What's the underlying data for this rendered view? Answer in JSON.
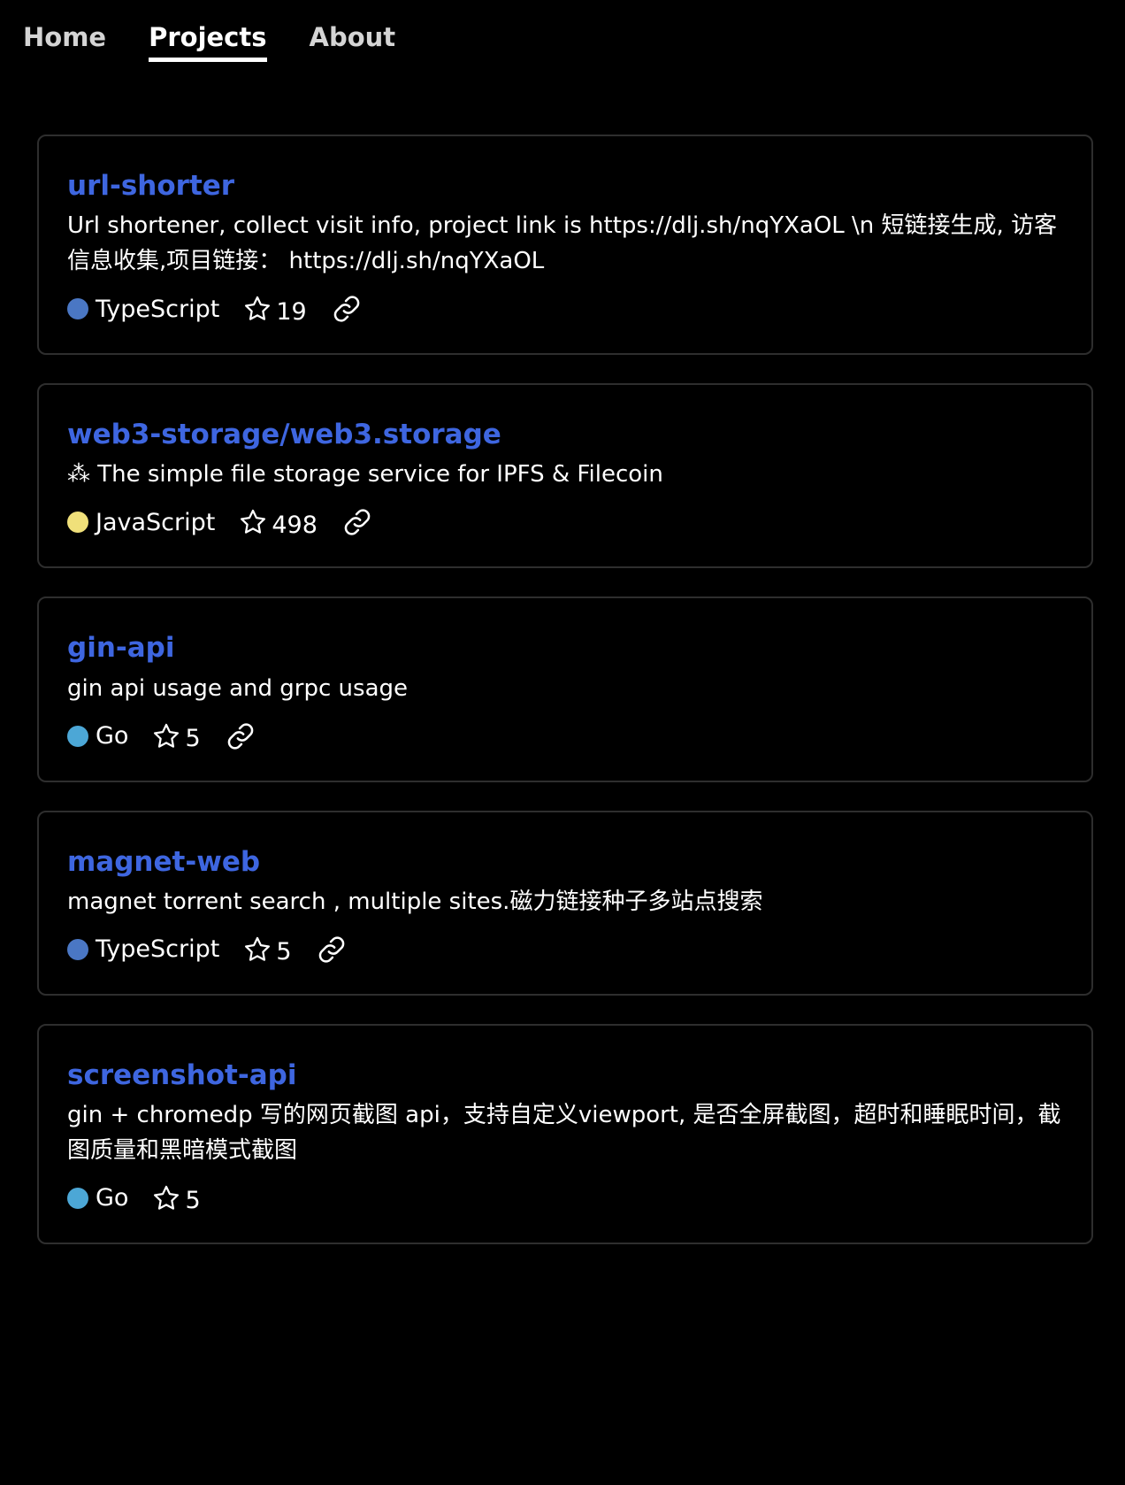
{
  "nav": {
    "items": [
      {
        "label": "Home",
        "active": false
      },
      {
        "label": "Projects",
        "active": true
      },
      {
        "label": "About",
        "active": false
      }
    ]
  },
  "colors": {
    "background": "#000000",
    "title": "#3e66e0",
    "typescript": "#4a77c4",
    "javascript": "#f0e07a",
    "go": "#4ca7d6"
  },
  "projects": [
    {
      "title": "url-shorter",
      "description": "Url shortener, collect visit info, project link is https://dlj.sh/nqYXaOL \\n 短链接生成, 访客信息收集,项目链接： https://dlj.sh/nqYXaOL",
      "language": "TypeScript",
      "language_color": "#4a77c4",
      "stars": "19",
      "has_link": true
    },
    {
      "title": "web3-storage/web3.storage",
      "description": "⁂ The simple file storage service for IPFS & Filecoin",
      "language": "JavaScript",
      "language_color": "#f0e07a",
      "stars": "498",
      "has_link": true
    },
    {
      "title": "gin-api",
      "description": "gin api usage and grpc usage",
      "language": "Go",
      "language_color": "#4ca7d6",
      "stars": "5",
      "has_link": true
    },
    {
      "title": "magnet-web",
      "description": "magnet torrent search , multiple sites.磁力链接种子多站点搜索",
      "language": "TypeScript",
      "language_color": "#4a77c4",
      "stars": "5",
      "has_link": true
    },
    {
      "title": "screenshot-api",
      "description": "gin + chromedp 写的网页截图 api，支持自定义viewport, 是否全屏截图，超时和睡眠时间，截图质量和黑暗模式截图",
      "language": "Go",
      "language_color": "#4ca7d6",
      "stars": "5",
      "has_link": false
    }
  ],
  "icons": {
    "star": "star-outline-icon",
    "link": "chain-link-icon"
  }
}
